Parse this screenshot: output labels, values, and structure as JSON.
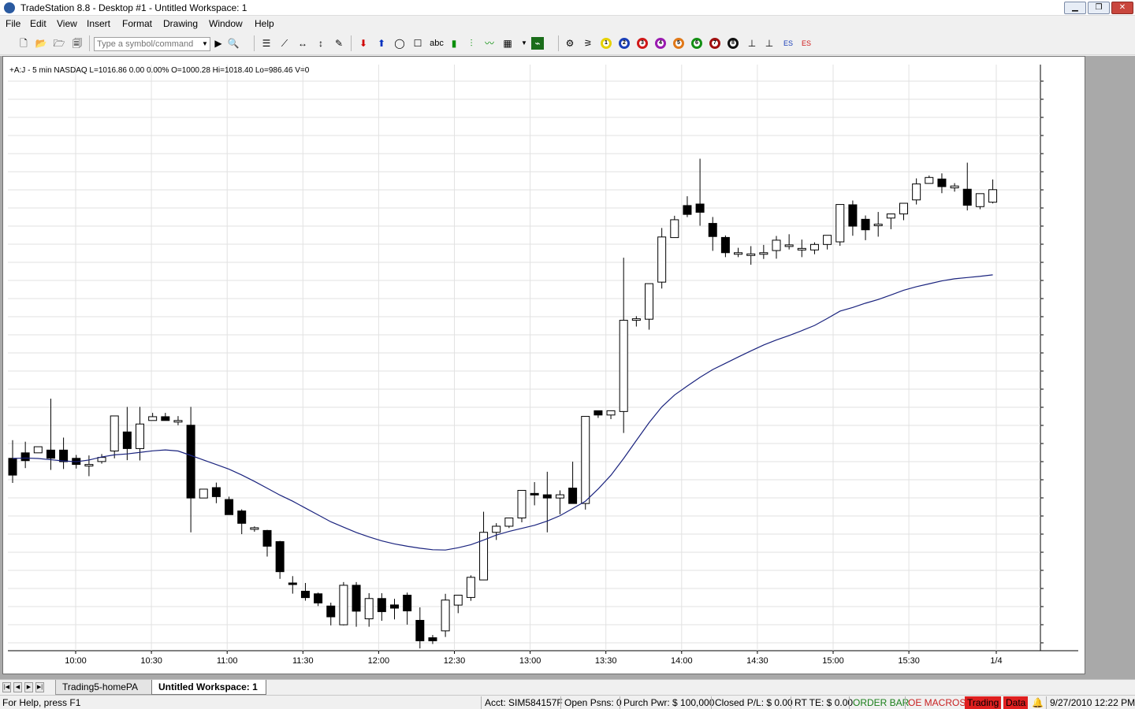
{
  "window": {
    "title": "TradeStation 8.8 - Desktop #1 - Untitled Workspace:  1"
  },
  "menu": [
    "File",
    "Edit",
    "View",
    "Insert",
    "Format",
    "Drawing",
    "Window",
    "Help"
  ],
  "toolbar": {
    "symbol_placeholder": "Type a symbol/command",
    "text_tool_label": "abc",
    "circle_labels": [
      "1",
      "2",
      "3",
      "4",
      "5",
      "6",
      "7",
      "8"
    ],
    "es_labels": [
      "ES",
      "ES"
    ]
  },
  "chart": {
    "info_line": "+A:J - 5 min  NASDAQ  L=1016.86  0.00  0.00%  O=1000.28  Hi=1018.40  Lo=986.46  V=0",
    "symbol": "+A:J",
    "interval": "5 min",
    "exchange": "NASDAQ",
    "last": "1016.86",
    "change": "0.00",
    "change_pct": "0.00%",
    "open": "1000.28",
    "high": "1018.40",
    "low": "986.46",
    "volume": "0"
  },
  "chart_data": {
    "type": "candlestick",
    "x_tick_labels": [
      "10:00",
      "10:30",
      "11:00",
      "11:30",
      "12:00",
      "12:30",
      "13:00",
      "13:30",
      "14:00",
      "14:30",
      "15:00",
      "15:30",
      "1/4"
    ],
    "ylim": [
      986.46,
      1018.4
    ],
    "grid": true,
    "colors": {
      "up_fill": "#ffffff",
      "down_fill": "#000000",
      "moving_average": "#1a237e",
      "grid": "#e2e2e2"
    },
    "series": [
      {
        "name": "price",
        "type": "ohlc",
        "ohlc": [
          [
            993.21,
            994.4,
            992.11,
            991.6
          ],
          [
            993.57,
            994.3,
            993.06,
            992.57
          ],
          [
            993.57,
            993.93,
            993.97,
            993.57
          ],
          [
            993.75,
            997.12,
            993.22,
            992.45
          ],
          [
            993.75,
            994.57,
            992.99,
            992.51
          ],
          [
            993.21,
            993.43,
            992.81,
            992.54
          ],
          [
            992.79,
            993.4,
            992.81,
            992.04
          ],
          [
            993.0,
            993.49,
            993.27,
            992.86
          ],
          [
            993.69,
            994.45,
            995.99,
            993.21
          ],
          [
            994.94,
            996.58,
            993.85,
            993.09
          ],
          [
            993.85,
            996.58,
            995.46,
            993.07
          ],
          [
            995.69,
            996.19,
            995.94,
            995.69
          ],
          [
            995.94,
            996.19,
            995.69,
            995.69
          ],
          [
            995.69,
            995.98,
            995.69,
            995.38
          ],
          [
            995.38,
            996.58,
            990.61,
            988.36
          ],
          [
            990.61,
            991.04,
            991.19,
            990.61
          ],
          [
            991.29,
            991.62,
            990.7,
            990.27
          ],
          [
            990.51,
            990.7,
            989.52,
            989.52
          ],
          [
            989.76,
            989.87,
            988.95,
            988.24
          ],
          [
            988.62,
            988.75,
            988.66,
            988.4
          ],
          [
            988.48,
            988.52,
            987.45,
            986.77
          ],
          [
            987.75,
            987.8,
            985.78,
            985.31
          ],
          [
            985.04,
            985.49,
            984.95,
            984.34
          ],
          [
            984.5,
            985.04,
            984.08,
            983.88
          ],
          [
            984.33,
            984.41,
            983.73,
            983.53
          ],
          [
            983.53,
            983.75,
            982.82,
            982.26
          ],
          [
            982.3,
            985.1,
            984.89,
            982.26
          ],
          [
            984.89,
            985.1,
            983.19,
            982.17
          ],
          [
            982.69,
            984.37,
            984.02,
            982.17
          ],
          [
            984.02,
            984.37,
            983.16,
            982.56
          ],
          [
            983.6,
            984.0,
            983.39,
            982.65
          ],
          [
            984.24,
            984.41,
            983.21,
            982.31
          ],
          [
            982.59,
            983.44,
            981.25,
            980.75
          ],
          [
            981.45,
            981.63,
            981.25,
            981.04
          ],
          [
            981.9,
            984.33,
            983.92,
            981.5
          ],
          [
            983.59,
            984.21,
            984.24,
            983.06
          ],
          [
            984.09,
            985.54,
            985.41,
            983.87
          ],
          [
            985.24,
            989.71,
            988.36,
            985.22
          ],
          [
            988.36,
            988.96,
            988.76,
            987.86
          ],
          [
            988.76,
            989.11,
            989.3,
            988.64
          ],
          [
            989.3,
            990.66,
            991.11,
            989.02
          ],
          [
            990.91,
            991.65,
            990.82,
            990.13
          ],
          [
            990.82,
            992.33,
            990.61,
            988.36
          ],
          [
            990.61,
            991.11,
            990.82,
            989.54
          ],
          [
            991.26,
            992.99,
            990.25,
            990.26
          ],
          [
            990.25,
            994.4,
            995.96,
            989.85
          ],
          [
            996.33,
            994.77,
            996.05,
            995.86
          ],
          [
            996.05,
            996.33,
            996.33,
            995.78
          ],
          [
            996.28,
            1006.36,
            1002.26,
            994.87
          ],
          [
            1002.36,
            1002.53,
            1002.36,
            1001.85
          ],
          [
            1002.33,
            1003.06,
            1004.66,
            1001.64
          ],
          [
            1004.76,
            1008.31,
            1007.72,
            1004.34
          ],
          [
            1007.68,
            1009.11,
            1008.85,
            1007.8
          ],
          [
            1009.78,
            1010.39,
            1009.2,
            1009.02
          ],
          [
            1009.88,
            1012.85,
            1009.34,
            1008.46
          ],
          [
            1008.61,
            1009.03,
            1007.75,
            1006.81
          ],
          [
            1007.69,
            1007.82,
            1006.69,
            1006.4
          ],
          [
            1006.69,
            1007.01,
            1006.69,
            1006.4
          ],
          [
            1006.61,
            1007.12,
            1006.61,
            1005.9
          ],
          [
            1006.61,
            1007.2,
            1006.69,
            1006.28
          ],
          [
            1006.83,
            1007.79,
            1007.51,
            1006.3
          ],
          [
            1007.2,
            1007.9,
            1007.2,
            1006.9
          ],
          [
            1006.96,
            1007.55,
            1006.97,
            1006.4
          ],
          [
            1006.87,
            1007.37,
            1007.23,
            1006.59
          ],
          [
            1007.23,
            1007.76,
            1007.83,
            1006.9
          ],
          [
            1007.4,
            1008.45,
            1009.85,
            1007.14
          ],
          [
            1009.83,
            1010.11,
            1008.43,
            1007.8
          ],
          [
            1008.88,
            1009.13,
            1008.19,
            1007.51
          ],
          [
            1008.54,
            1009.36,
            1008.56,
            1007.74
          ],
          [
            1008.96,
            1009.25,
            1009.23,
            1008.23
          ],
          [
            1009.23,
            1009.89,
            1009.93,
            1008.82
          ],
          [
            1010.15,
            1011.56,
            1011.2,
            1009.85
          ],
          [
            1011.23,
            1011.75,
            1011.62,
            1011.22
          ],
          [
            1011.52,
            1011.89,
            1011.02,
            1010.59
          ],
          [
            1010.94,
            1011.25,
            1011.06,
            1010.69
          ],
          [
            1010.85,
            1012.59,
            1009.8,
            1009.46
          ],
          [
            1009.71,
            1010.26,
            1010.56,
            1009.54
          ],
          [
            1010.0,
            1011.49,
            1010.82,
            1009.92
          ]
        ]
      },
      {
        "name": "",
        "type": "moving_average",
        "values": [
          993.2,
          993.23,
          993.2,
          993.12,
          993.04,
          992.99,
          993.1,
          993.3,
          993.44,
          993.5,
          993.6,
          993.7,
          993.76,
          993.69,
          993.4,
          993.1,
          992.8,
          992.5,
          992.12,
          991.7,
          991.25,
          990.8,
          990.4,
          989.95,
          989.5,
          989.05,
          988.7,
          988.35,
          988.06,
          987.8,
          987.6,
          987.45,
          987.32,
          987.22,
          987.2,
          987.35,
          987.55,
          987.85,
          988.18,
          988.42,
          988.62,
          988.82,
          989.1,
          989.45,
          989.92,
          990.4,
          991.2,
          992.1,
          993.2,
          994.38,
          995.55,
          996.58,
          997.36,
          997.95,
          998.52,
          999.03,
          999.44,
          999.85,
          1000.25,
          1000.64,
          1000.97,
          1001.26,
          1001.58,
          1001.92,
          1002.38,
          1002.86,
          1003.1,
          1003.38,
          1003.62,
          1003.92,
          1004.23,
          1004.46,
          1004.65,
          1004.84,
          1004.98,
          1005.06,
          1005.14,
          1005.24
        ]
      }
    ]
  },
  "tabs": [
    "Trading5-homePA",
    "Untitled Workspace:  1"
  ],
  "status": {
    "help": "For Help, press F1",
    "account": "Acct: SIM584157F",
    "open_positions": "Open Psns: 0",
    "purchasing_power": "Purch Pwr: $ 100,000",
    "closed_pl": "Closed P/L: $ 0.00",
    "rt_te": "RT TE: $ 0.00",
    "order_bar": "ORDER BAR",
    "oe_macros": "OE MACROS",
    "trading": "Trading",
    "data": "Data",
    "datetime": "9/27/2010 12:22 PM",
    "colors": {
      "green": "#1a7f1a",
      "red_text": "#c82020",
      "red_bg": "#e01f1f"
    }
  }
}
